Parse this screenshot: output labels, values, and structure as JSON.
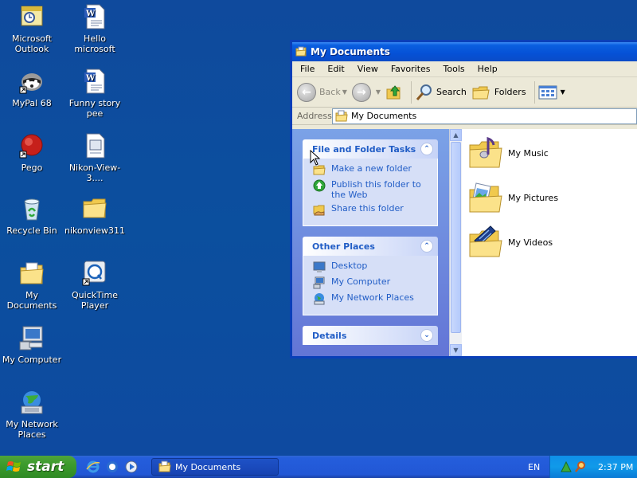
{
  "desktop": {
    "icons": [
      {
        "label": "Microsoft Outlook",
        "icon": "outlook-icon"
      },
      {
        "label": "Hello microsoft",
        "icon": "word-doc-icon"
      },
      {
        "label": "MyPal 68",
        "icon": "mypal-icon"
      },
      {
        "label": "Funny story pee",
        "icon": "word-doc-icon"
      },
      {
        "label": "Pego",
        "icon": "pego-icon"
      },
      {
        "label": "Nikon-View-3....",
        "icon": "document-icon"
      },
      {
        "label": "Recycle Bin",
        "icon": "recycle-bin-icon"
      },
      {
        "label": "nikonview311",
        "icon": "folder-icon"
      },
      {
        "label": "My Documents",
        "icon": "my-documents-icon"
      },
      {
        "label": "QuickTime Player",
        "icon": "quicktime-icon"
      },
      {
        "label": "My Computer",
        "icon": "my-computer-icon"
      },
      {
        "label": "My Network Places",
        "icon": "network-icon"
      }
    ]
  },
  "window": {
    "title": "My Documents",
    "menu": [
      "File",
      "Edit",
      "View",
      "Favorites",
      "Tools",
      "Help"
    ],
    "toolbar": {
      "back": "Back",
      "search": "Search",
      "folders": "Folders"
    },
    "address": {
      "label": "Address",
      "value": "My Documents"
    },
    "tasks": {
      "file_folder": {
        "title": "File and Folder Tasks",
        "links": [
          "Make a new folder",
          "Publish this folder to the Web",
          "Share this folder"
        ]
      },
      "other_places": {
        "title": "Other Places",
        "links": [
          "Desktop",
          "My Computer",
          "My Network Places"
        ]
      },
      "details": {
        "title": "Details"
      }
    },
    "files": [
      "My Music",
      "My Pictures",
      "My Videos"
    ]
  },
  "taskbar": {
    "start": "start",
    "task_button": "My Documents",
    "language": "EN",
    "clock": "2:37 PM"
  },
  "colors": {
    "desktop": "#0b4f9e",
    "title_bar": "#0551d6",
    "start_button": "#3c9b2c",
    "task_link": "#215dc6"
  }
}
